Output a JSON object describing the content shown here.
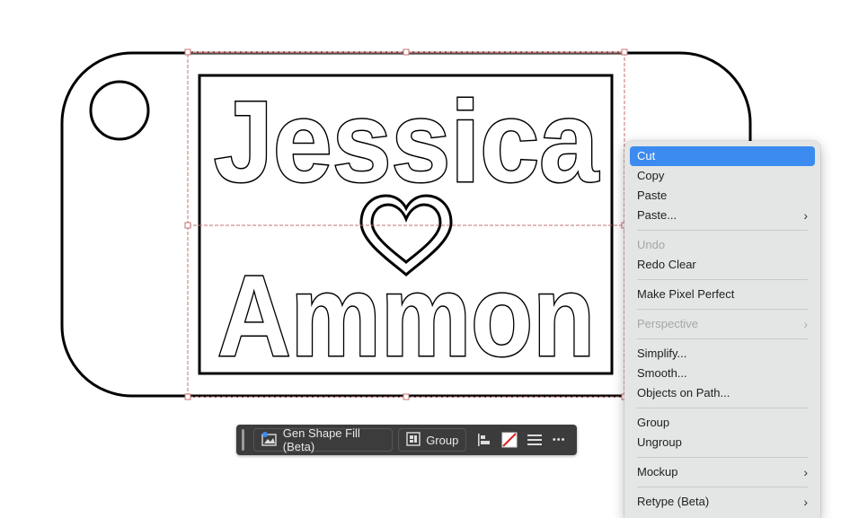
{
  "artwork": {
    "line1": "Jessica",
    "line2": "Ammon"
  },
  "taskbar": {
    "gen_shape_fill_label": "Gen Shape Fill (Beta)",
    "group_label": "Group",
    "more_label": "•••"
  },
  "context_menu": {
    "items": [
      {
        "label": "Cut",
        "state": "highlighted"
      },
      {
        "label": "Copy"
      },
      {
        "label": "Paste"
      },
      {
        "label": "Paste...",
        "submenu": true
      },
      {
        "label": "Undo",
        "state": "disabled"
      },
      {
        "label": "Redo Clear"
      },
      {
        "label": "Make Pixel Perfect"
      },
      {
        "label": "Perspective",
        "state": "disabled",
        "submenu": true
      },
      {
        "label": "Simplify..."
      },
      {
        "label": "Smooth..."
      },
      {
        "label": "Objects on Path..."
      },
      {
        "label": "Group"
      },
      {
        "label": "Ungroup"
      },
      {
        "label": "Mockup",
        "submenu": true
      },
      {
        "label": "Retype (Beta)",
        "submenu": true
      }
    ]
  },
  "colors": {
    "selection": "#c47070",
    "menu_highlight": "#3b8bf0",
    "taskbar_bg": "#3c3c3c"
  }
}
